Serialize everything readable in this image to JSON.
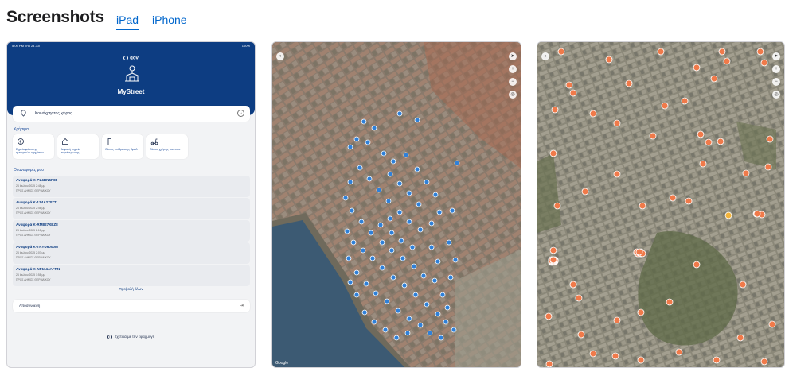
{
  "header": {
    "title": "Screenshots",
    "tabs": [
      {
        "label": "iPad",
        "active": true
      },
      {
        "label": "iPhone",
        "active": false
      }
    ]
  },
  "app": {
    "status_time": "5:09 PM",
    "status_date": "Thu 24 Jul",
    "status_battery": "100%",
    "brand": "gov",
    "name": "MyStreet",
    "location_label": "Κοινόχρηστος χώρος",
    "useful_label": "Χρήσιμα",
    "quick_actions": [
      {
        "label": "Σημεία φόρτισης ηλεκτρικών οχημάτων",
        "icon": "ev-charger-icon"
      },
      {
        "label": "Ασφαλή σημεία συγκέντρωσης",
        "icon": "safe-zone-icon"
      },
      {
        "label": "Θέσεις στάθμευσης AμεΑ",
        "icon": "parking-icon"
      },
      {
        "label": "Θέσεις χρήσης πατινιών",
        "icon": "scooter-icon"
      }
    ],
    "reports_label": "Οι αναφορές μου",
    "reports": [
      {
        "id": "Αναφορά Κ-PZ4BN5P88",
        "date": "24 Ιουλίου 2025 2:48 μμ",
        "status": "ΠΡΟΣ ΔΗΜΟΣ ΘΕΡΜΑΪΚΟΥ"
      },
      {
        "id": "Αναφορά Κ-1Z4A2707T",
        "date": "24 Ιουλίου 2025 2:46 μμ",
        "status": "ΠΡΟΣ ΔΗΜΟΣ ΘΕΡΜΑΪΚΟΥ"
      },
      {
        "id": "Αναφορά Κ-RM827XEZ8",
        "date": "24 Ιουλίου 2025 2:18 μμ",
        "status": "ΠΡΟΣ ΔΗΜΟΣ ΘΕΡΜΑΪΚΟΥ"
      },
      {
        "id": "Αναφορά Κ-TRYU6000M",
        "date": "24 Ιουλίου 2025 2:07 μμ",
        "status": "ΠΡΟΣ ΔΗΜΟΣ ΘΕΡΜΑΪΚΟΥ"
      },
      {
        "id": "Αναφορά Κ-NF1144AFRN",
        "date": "24 Ιουλίου 2025 1:58 μμ",
        "status": "ΠΡΟΣ ΔΗΜΟΣ ΘΕΡΜΑΪΚΟΥ"
      }
    ],
    "view_all": "Προβολή όλων",
    "logout": "Αποσύνδεση",
    "faq": "Σχετικά με την εφαρμογή"
  },
  "map1": {
    "attribution": "Google"
  },
  "colors": {
    "accent": "#0066cc",
    "banner": "#0d3d82",
    "pin_blue": "#2f80d8",
    "pin_orange": "#f07a4a"
  }
}
